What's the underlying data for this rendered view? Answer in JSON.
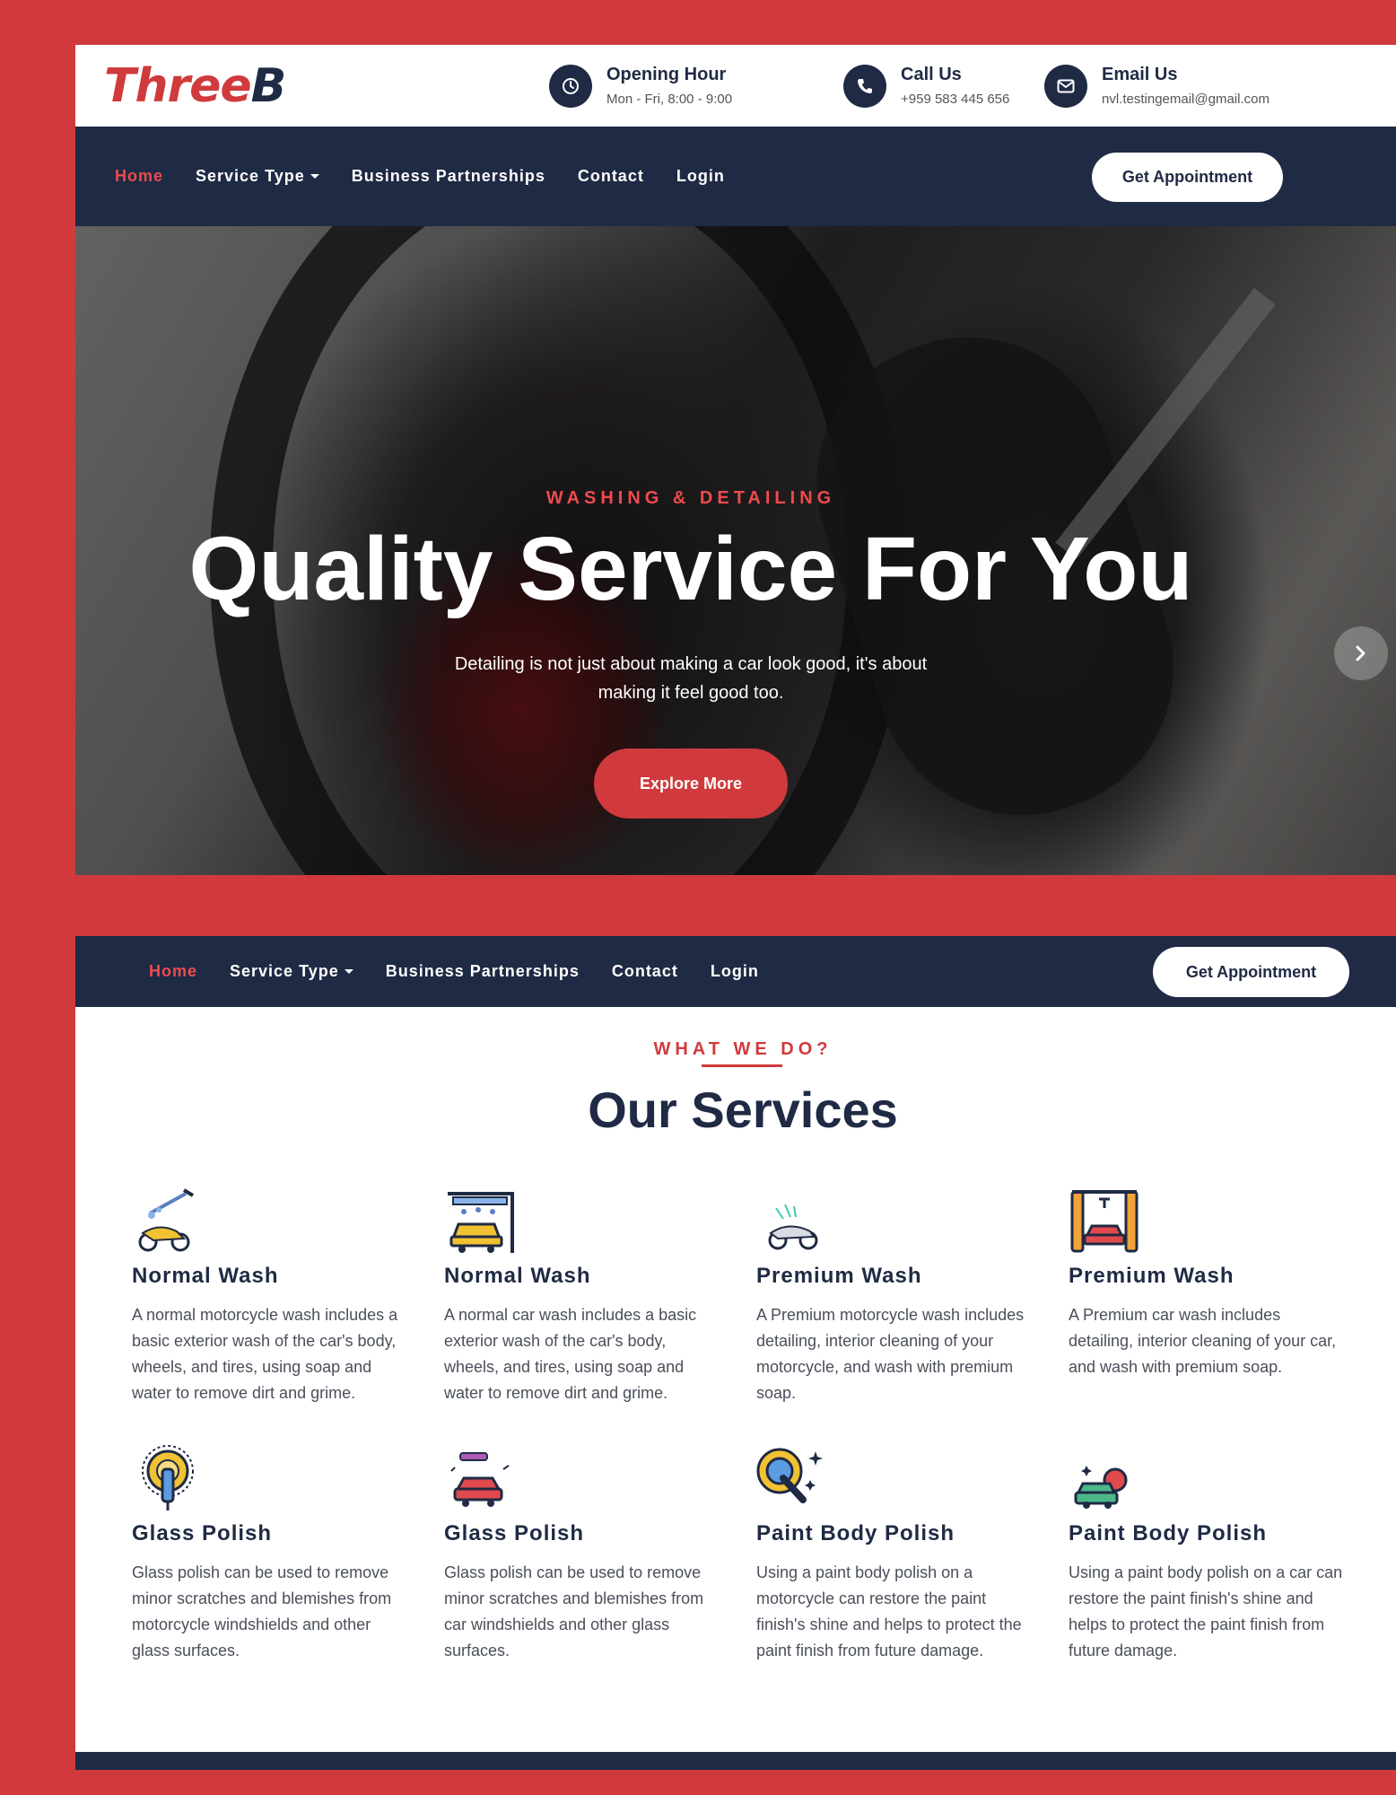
{
  "brand": {
    "part1": "Three",
    "part2": "B"
  },
  "contact": [
    {
      "title": "Opening Hour",
      "value": "Mon - Fri, 8:00 - 9:00",
      "icon": "clock-icon"
    },
    {
      "title": "Call Us",
      "value": "+959 583 445 656",
      "icon": "phone-icon"
    },
    {
      "title": "Email Us",
      "value": "nvl.testingemail@gmail.com",
      "icon": "envelope-icon"
    }
  ],
  "nav": {
    "items": [
      {
        "label": "Home",
        "active": true
      },
      {
        "label": "Service Type",
        "dropdown": true
      },
      {
        "label": "Business Partnerships"
      },
      {
        "label": "Contact"
      },
      {
        "label": "Login"
      }
    ],
    "cta": "Get Appointment"
  },
  "hero": {
    "subtitle": "WASHING & DETAILING",
    "title": "Quality Service For You",
    "description": "Detailing is not just about making a car look good, it's about making it feel good too.",
    "button": "Explore More"
  },
  "services": {
    "eyebrow": "WHAT WE DO?",
    "title": "Our Services",
    "items": [
      {
        "title": "Normal Wash",
        "desc": "A normal motorcycle wash includes a basic exterior wash of the car's body, wheels, and tires, using soap and water to remove dirt and grime.",
        "icon": "motorcycle-wash-icon"
      },
      {
        "title": "Normal Wash",
        "desc": "A normal car wash includes a basic exterior wash of the car's body, wheels, and tires, using soap and water to remove dirt and grime.",
        "icon": "car-wash-icon"
      },
      {
        "title": "Premium Wash",
        "desc": "A Premium motorcycle wash includes detailing, interior cleaning of your motorcycle, and wash with premium soap.",
        "icon": "motorcycle-premium-icon"
      },
      {
        "title": "Premium Wash",
        "desc": "A Premium car wash includes detailing, interior cleaning of your car, and wash with premium soap.",
        "icon": "car-premium-wash-icon"
      },
      {
        "title": "Glass Polish",
        "desc": "Glass polish can be used to remove minor scratches and blemishes from motorcycle windshields and other glass surfaces.",
        "icon": "glass-polish-brush-icon"
      },
      {
        "title": "Glass Polish",
        "desc": "Glass polish can be used to remove minor scratches and blemishes from car windshields and other glass surfaces.",
        "icon": "car-glass-polish-icon"
      },
      {
        "title": "Paint Body Polish",
        "desc": "Using a paint body polish on a motorcycle can restore the paint finish's shine and helps to protect the paint finish from future damage.",
        "icon": "polisher-icon"
      },
      {
        "title": "Paint Body Polish",
        "desc": "Using a paint body polish on a car can restore the paint finish's shine and helps to protect the paint finish from future damage.",
        "icon": "car-polish-icon"
      }
    ]
  },
  "colors": {
    "accent": "#d03a3c",
    "navy": "#1f2a44"
  }
}
